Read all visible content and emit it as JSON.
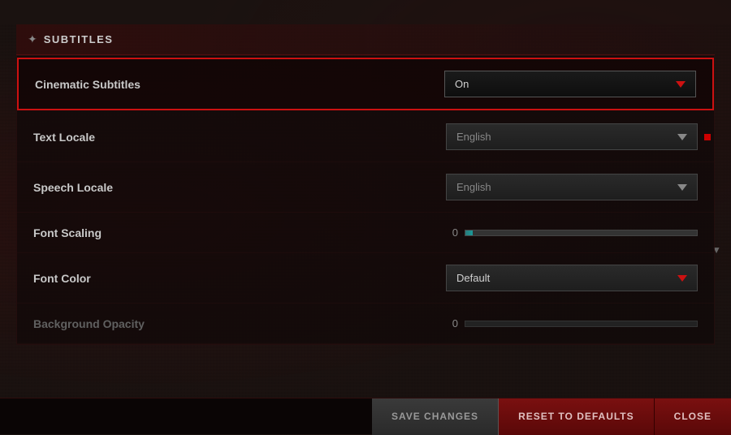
{
  "section": {
    "icon": "✦",
    "title": "SUBTITLES"
  },
  "settings": [
    {
      "id": "cinematic-subtitles",
      "label": "Cinematic Subtitles",
      "type": "dropdown",
      "value": "On",
      "highlighted": true,
      "dimmed": false
    },
    {
      "id": "text-locale",
      "label": "Text Locale",
      "type": "dropdown",
      "value": "English",
      "highlighted": false,
      "dimmed": false,
      "has_red_dot": true
    },
    {
      "id": "speech-locale",
      "label": "Speech Locale",
      "type": "dropdown",
      "value": "English",
      "highlighted": false,
      "dimmed": false
    },
    {
      "id": "font-scaling",
      "label": "Font Scaling",
      "type": "slider",
      "value": "0",
      "highlighted": false,
      "dimmed": false
    },
    {
      "id": "font-color",
      "label": "Font Color",
      "type": "dropdown",
      "value": "Default",
      "highlighted": false,
      "dimmed": false
    },
    {
      "id": "background-opacity",
      "label": "Background Opacity",
      "type": "slider",
      "value": "0",
      "highlighted": false,
      "dimmed": true
    }
  ],
  "buttons": {
    "save": "SAVE CHANGES",
    "reset": "RESET TO DEFAULTS",
    "close": "CLOSE"
  }
}
